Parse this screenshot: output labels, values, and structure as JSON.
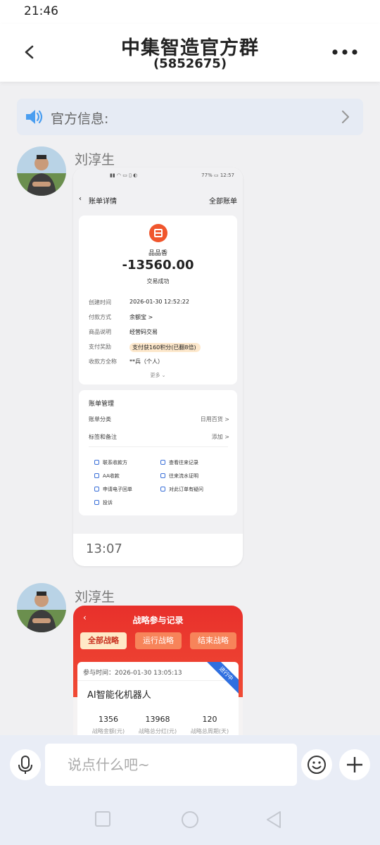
{
  "status_bar": {
    "time": "21:46"
  },
  "header": {
    "title": "中集智造官方群",
    "subtitle": "(5852675)"
  },
  "notice": {
    "label": "官方信息:"
  },
  "messages": [
    {
      "sender": "刘淳生",
      "time": "13:07",
      "screenshot": {
        "status_battery": "77%",
        "status_time": "12:57",
        "nav_title": "账单详情",
        "nav_right": "全部账单",
        "merchant": "品品香",
        "amount": "-13560.00",
        "status": "交易成功",
        "rows": [
          {
            "label": "创建时间",
            "value": "2026-01-30 12:52:22"
          },
          {
            "label": "付款方式",
            "value": "余额宝 >"
          },
          {
            "label": "商品说明",
            "value": "经营码交易"
          },
          {
            "label": "支付奖励",
            "value": "支付获160积分(已翻8倍)"
          },
          {
            "label": "收款方全称",
            "value": "**兵（个人）"
          }
        ],
        "more": "更多",
        "manage_title": "账单管理",
        "manage_rows": [
          {
            "label": "账单分类",
            "value": "日用百货 >"
          },
          {
            "label": "标签和备注",
            "value": "添加 >"
          }
        ],
        "actions": [
          "联系收款方",
          "查看往来记录",
          "AA收款",
          "往来流水证明",
          "申请电子回单",
          "对此订单有疑问",
          "投诉"
        ]
      }
    },
    {
      "sender": "刘淳生",
      "screenshot": {
        "title": "战略参与记录",
        "tabs": [
          "全部战略",
          "运行战略",
          "结束战略"
        ],
        "time_label": "参与时间：2026-01-30 13:05:13",
        "ribbon": "进行中",
        "product": "AI智能化机器人",
        "stats": [
          {
            "value": "1356",
            "label": "战略金额(元)"
          },
          {
            "value": "13968",
            "label": "战略总分红(元)"
          },
          {
            "value": "120",
            "label": "战略总周期(天)"
          }
        ]
      }
    }
  ],
  "input": {
    "placeholder": "说点什么吧~"
  }
}
